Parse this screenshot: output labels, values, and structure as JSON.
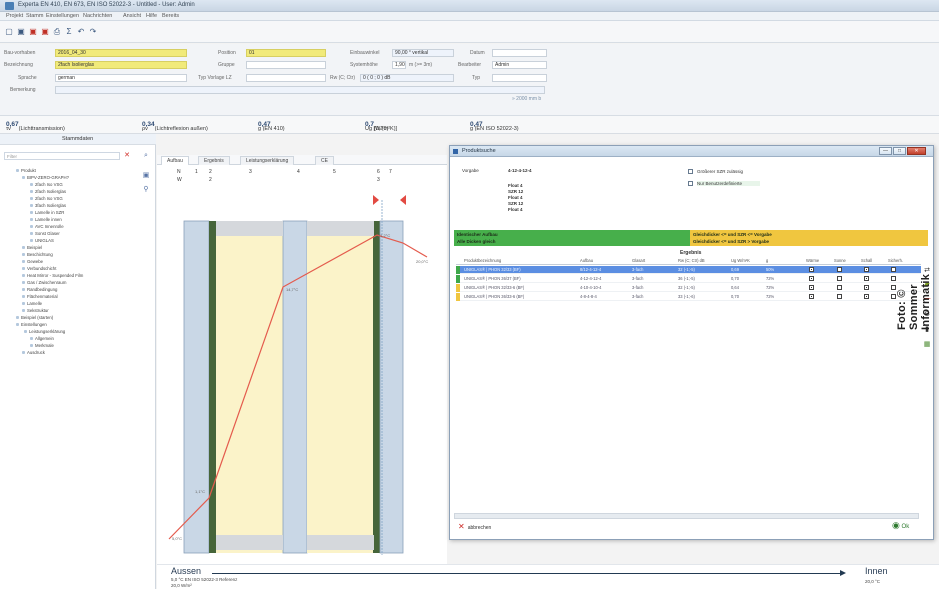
{
  "window": {
    "title": "Experta EN 410, EN 673, EN ISO 52022-3 - Untitled - User: Admin"
  },
  "menu": [
    "Projekt",
    "Stamm",
    "Einstellungen",
    "Nachrichten",
    "Ansicht",
    "Hilfe",
    "Bereits"
  ],
  "form": {
    "row1": {
      "bau_label": "Bau-vorhaben",
      "bau_value": "2016_04_30",
      "pos_label": "Position",
      "pos_value": "01",
      "einbau_label": "Einbauwinkel",
      "einbau_value": "90,00 ° vertikal",
      "datum_label": "Datum"
    },
    "row2": {
      "bez_label": "Bezeichnung",
      "bez_value": "2fach Isolierglas",
      "gruppe_label": "Gruppe",
      "system_label": "Systemhöhe",
      "system_value": "1,90",
      "system_unit": "m (>= 3m)",
      "bearbeiter_label": "Bearbeiter",
      "bearbeiter_value": "Admin"
    },
    "row3": {
      "sprache_label": "Sprache",
      "sprache_value": "german",
      "typ_label": "Typ Vorlage LZ",
      "rw_label": "Rw (C; Ctr)",
      "rw_values": "0 ( 0 ; 0 ) dB",
      "typ2_label": "Typ"
    },
    "row4": {
      "bemerkung_label": "Bemerkung",
      "link": "» 2000 mm b"
    }
  },
  "summary": [
    {
      "label": "τv",
      "value": "0,67",
      "unit": "(Lichttransmission)"
    },
    {
      "label": "ρv",
      "value": "0,34",
      "unit": "(Lichtreflexion außen)"
    },
    {
      "label": "g (EN 410)",
      "value": "0,47",
      "unit": ""
    },
    {
      "label": "Ug [W/(m²K)]",
      "value": "0,7",
      "unit": "(0,70)"
    },
    {
      "label": "g (EN ISO 52022-3)",
      "value": "0,47",
      "unit": ""
    }
  ],
  "stammdaten": {
    "header": "Stammdaten",
    "filter": "Filter",
    "tree": [
      "Produkt",
      "BIPV-ZERO-GRAPH?",
      "2fach Iso VSG",
      "2fach Isolierglas",
      "2fach Iso VSG",
      "3fach Isolierglas",
      "Lamelle in SZR",
      "Lamelle innen",
      "AVC Innenrolle",
      "Sonst Glaser",
      "UNIGLAS",
      "Beispiel",
      "Beschichtung",
      "Gewebe",
      "Verbundschicht",
      "Heat Mirror - Suspended Film",
      "Gas / Zwischenraum",
      "Randbedingung",
      "Flächenmaterial",
      "Lamelle",
      "Sekstruktur",
      "Beispiel (starten)",
      "Einstellungen",
      "Leistungserklärung",
      "Allgemein",
      "Merkmale",
      "Ausdruck"
    ]
  },
  "tabs": [
    "Aufbau",
    "Ergebnis",
    "Leistungserklärung",
    "CE"
  ],
  "drawing": {
    "layer_numbers": [
      "N",
      "1",
      "2",
      "3",
      "4",
      "5",
      "6",
      "7"
    ],
    "row2": [
      "W",
      "",
      "2",
      "",
      "",
      "",
      "3",
      ""
    ],
    "temps": [
      "5,0°C",
      "1,1°C",
      "14,7°C",
      "21,2°C",
      "20,0°C"
    ],
    "aussen": "Aussen",
    "innen": "Innen",
    "aussen_sub": "5,0 °C   EN ISO 52022-3 Referenz",
    "aussen_sub2": "20,0 W/m²",
    "innen_sub": "20,0 °C"
  },
  "dialog": {
    "title": "Produktsuche",
    "vorgabe_label": "Vorgabe",
    "vorgabe": "4-12-4-12-4",
    "spec_lines": [
      "Float 4",
      "SZR 12",
      "Float 4",
      "SZR 12",
      "Float 4"
    ],
    "option1": "Größerer SZR zulässig",
    "option2": "Nur Benutzerdefinierte",
    "legend_left": [
      "Identischer Aufbau",
      "Alle Dicken gleich"
    ],
    "legend_right": [
      "Gleichdicker <= und SZR <= Vorgabe",
      "Gleichdicker <= und SZR > Vorgabe"
    ],
    "ergebnis": "Ergebnis",
    "headers": [
      "Produktbezeichnung",
      "Aufbau",
      "Glasart",
      "Rw (C; Ctr) dB",
      "Ug W/m²K",
      "g",
      "Wärme",
      "Sonne",
      "Schall",
      "Sicherh."
    ],
    "rows": [
      {
        "name": "UNIGLAS® | PHON 32/33 (BF)",
        "aufbau": "8/12-4-12-4",
        "art": "3-fach",
        "rw": "32 (-1;-5)",
        "ug": "0,69",
        "g": "50%",
        "marker": "#3ea74a",
        "checks": [
          true,
          false,
          true,
          false
        ]
      },
      {
        "name": "UNIGLAS® | PHON 36/37 (BF)",
        "aufbau": "4-12-4-12-4",
        "art": "3-fach",
        "rw": "36 (-1;-5)",
        "ug": "0,70",
        "g": "72%",
        "marker": "#3ea74a",
        "checks": [
          true,
          false,
          true,
          false
        ]
      },
      {
        "name": "UNIGLAS® | PHON 32/33-6 (BF)",
        "aufbau": "4-10-4-10-4",
        "art": "3-fach",
        "rw": "32 (-1;-5)",
        "ug": "0,64",
        "g": "72%",
        "marker": "#f0c63f",
        "checks": [
          true,
          false,
          true,
          false
        ]
      },
      {
        "name": "UNIGLAS® | PHON 36/33-6 (BF)",
        "aufbau": "4-8-4-8-4",
        "art": "3-fach",
        "rw": "33 (-1;-6)",
        "ug": "0,70",
        "g": "72%",
        "marker": "#f0c63f",
        "checks": [
          true,
          false,
          true,
          false
        ]
      }
    ],
    "cancel": "abbrechen",
    "ok": "Ok"
  },
  "watermark": "Foto: © Sommer Informatik"
}
